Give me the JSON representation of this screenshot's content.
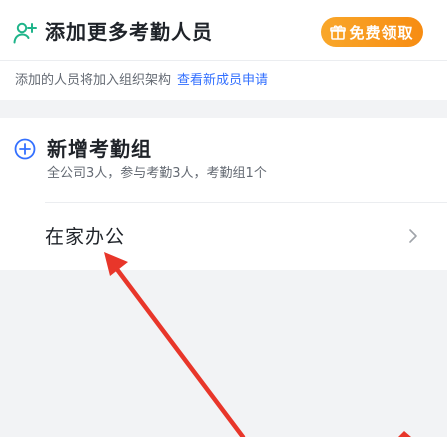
{
  "header": {
    "title": "添加更多考勤人员",
    "claim_button_label": "免费领取"
  },
  "info": {
    "text": "添加的人员将加入组织架构",
    "link_text": "查看新成员申请"
  },
  "add_group": {
    "title": "新增考勤组",
    "subtitle": "全公司3人，参与考勤3人，考勤组1个"
  },
  "groups": [
    {
      "name": "在家办公"
    }
  ],
  "colors": {
    "accent_green": "#1fb48a",
    "accent_blue": "#3370ff",
    "claim_orange": "#f7961d",
    "arrow_red": "#e8362a"
  }
}
